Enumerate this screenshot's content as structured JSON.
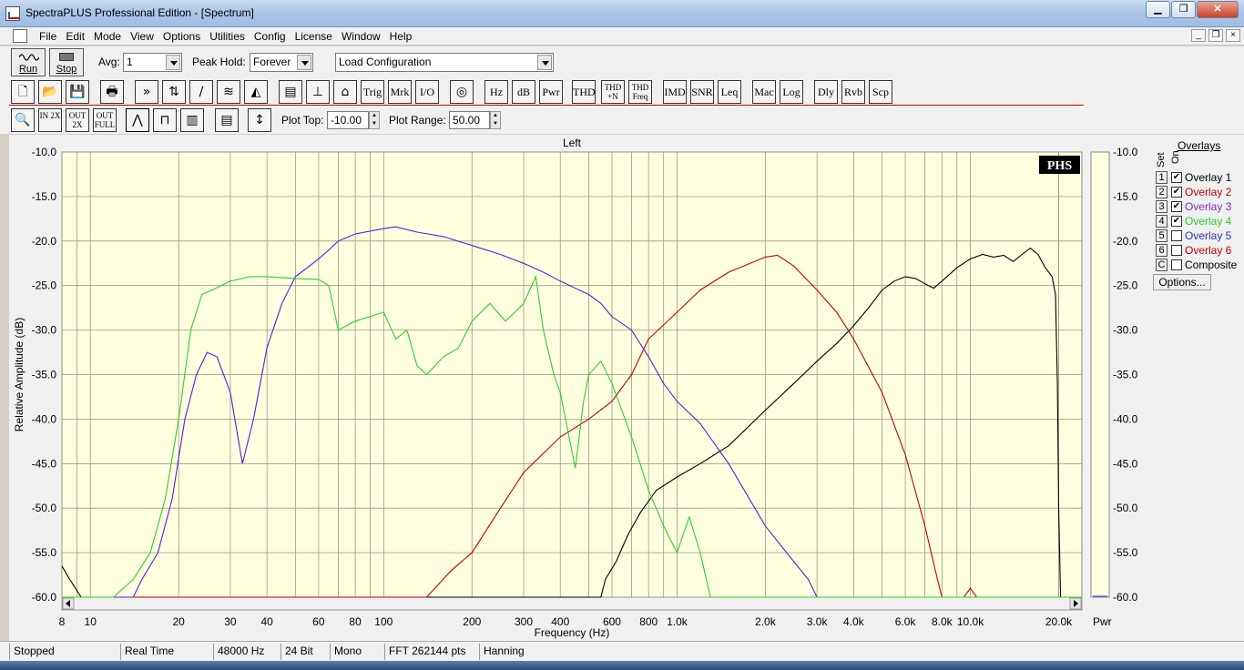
{
  "window": {
    "title": "SpectraPLUS Professional Edition - [Spectrum]"
  },
  "window_buttons": {
    "minimize": "▁",
    "restore": "❐",
    "close": "✕"
  },
  "menu": [
    "File",
    "Edit",
    "Mode",
    "View",
    "Options",
    "Utilities",
    "Config",
    "License",
    "Window",
    "Help"
  ],
  "mdi_buttons": {
    "minimize": "_",
    "restore": "❐",
    "close": "×"
  },
  "toolbar1": {
    "run_label": "Run",
    "stop_label": "Stop",
    "avg_label": "Avg:",
    "avg_value": "1",
    "peakhold_label": "Peak Hold:",
    "peakhold_value": "Forever",
    "config_value": "Load Configuration"
  },
  "toolbar2": {
    "buttons": [
      "Trig",
      "Mrk",
      "I/O",
      "Hz",
      "dB",
      "Pwr",
      "THD",
      "THD +N",
      "THD Freq",
      "IMD",
      "SNR",
      "Leq",
      "Mac",
      "Log",
      "Dly",
      "Rvb",
      "Scp"
    ]
  },
  "toolbar3": {
    "zoom_in_label": "IN 2X",
    "zoom_out_label": "OUT 2X",
    "zoom_full_label": "OUT FULL",
    "plot_top_label": "Plot Top:",
    "plot_top_value": "-10.00",
    "plot_range_label": "Plot Range:",
    "plot_range_value": "50.00"
  },
  "chart_data": {
    "type": "line",
    "title": "Left",
    "xlabel": "Frequency (Hz)",
    "ylabel": "Relative Amplitude (dB)",
    "x_scale": "log",
    "xlim": [
      8,
      24000
    ],
    "ylim": [
      -60,
      -10
    ],
    "x_ticks": [
      {
        "v": 8,
        "t": "8"
      },
      {
        "v": 10,
        "t": "10"
      },
      {
        "v": 20,
        "t": "20"
      },
      {
        "v": 30,
        "t": "30"
      },
      {
        "v": 40,
        "t": "40"
      },
      {
        "v": 60,
        "t": "60"
      },
      {
        "v": 80,
        "t": "80"
      },
      {
        "v": 100,
        "t": "100"
      },
      {
        "v": 200,
        "t": "200"
      },
      {
        "v": 300,
        "t": "300"
      },
      {
        "v": 400,
        "t": "400"
      },
      {
        "v": 600,
        "t": "600"
      },
      {
        "v": 800,
        "t": "800"
      },
      {
        "v": 1000,
        "t": "1.0k"
      },
      {
        "v": 2000,
        "t": "2.0k"
      },
      {
        "v": 3000,
        "t": "3.0k"
      },
      {
        "v": 4000,
        "t": "4.0k"
      },
      {
        "v": 6000,
        "t": "6.0k"
      },
      {
        "v": 8000,
        "t": "8.0k"
      },
      {
        "v": 10000,
        "t": "10.0k"
      },
      {
        "v": 20000,
        "t": "20.0k"
      }
    ],
    "y_ticks": [
      {
        "v": -10,
        "t": "-10.0"
      },
      {
        "v": -15,
        "t": "-15.0"
      },
      {
        "v": -20,
        "t": "-20.0"
      },
      {
        "v": -25,
        "t": "-25.0"
      },
      {
        "v": -30,
        "t": "-30.0"
      },
      {
        "v": -35,
        "t": "-35.0"
      },
      {
        "v": -40,
        "t": "-40.0"
      },
      {
        "v": -45,
        "t": "-45.0"
      },
      {
        "v": -50,
        "t": "-50.0"
      },
      {
        "v": -55,
        "t": "-55.0"
      },
      {
        "v": -60,
        "t": "-60.0"
      }
    ],
    "grid": true,
    "watermark": "PHS",
    "pwr_label": "Pwr",
    "series": [
      {
        "name": "Overlay 1",
        "color": "#000000",
        "points": [
          [
            8,
            -56.5
          ],
          [
            8.5,
            -58
          ],
          [
            9.3,
            -60
          ],
          [
            10,
            -60
          ],
          [
            100,
            -60
          ],
          [
            550,
            -60
          ],
          [
            570,
            -58
          ],
          [
            620,
            -56
          ],
          [
            680,
            -53
          ],
          [
            750,
            -50.5
          ],
          [
            850,
            -48
          ],
          [
            1000,
            -46.5
          ],
          [
            1200,
            -45
          ],
          [
            1500,
            -43
          ],
          [
            2000,
            -39
          ],
          [
            2500,
            -36
          ],
          [
            3000,
            -33.5
          ],
          [
            3500,
            -31.5
          ],
          [
            4000,
            -29.5
          ],
          [
            4500,
            -27.5
          ],
          [
            5000,
            -25.5
          ],
          [
            5500,
            -24.5
          ],
          [
            6000,
            -24
          ],
          [
            6500,
            -24.2
          ],
          [
            7000,
            -24.8
          ],
          [
            7500,
            -25.3
          ],
          [
            8000,
            -24.5
          ],
          [
            9000,
            -23
          ],
          [
            10000,
            -22
          ],
          [
            11000,
            -21.5
          ],
          [
            12000,
            -21.8
          ],
          [
            13000,
            -21.6
          ],
          [
            14000,
            -22.3
          ],
          [
            15000,
            -21.5
          ],
          [
            16000,
            -20.8
          ],
          [
            17000,
            -21.5
          ],
          [
            18000,
            -23
          ],
          [
            19000,
            -24
          ],
          [
            19500,
            -26
          ],
          [
            19800,
            -36
          ],
          [
            20000,
            -50
          ],
          [
            20300,
            -60
          ],
          [
            24000,
            -60
          ]
        ]
      },
      {
        "name": "Overlay 2",
        "color": "#c00000",
        "points": [
          [
            8,
            -60
          ],
          [
            140,
            -60
          ],
          [
            170,
            -57
          ],
          [
            200,
            -55
          ],
          [
            250,
            -50
          ],
          [
            300,
            -46
          ],
          [
            400,
            -42
          ],
          [
            500,
            -40
          ],
          [
            600,
            -38
          ],
          [
            700,
            -35
          ],
          [
            800,
            -31
          ],
          [
            1000,
            -28
          ],
          [
            1200,
            -25.5
          ],
          [
            1500,
            -23.5
          ],
          [
            2000,
            -21.8
          ],
          [
            2200,
            -21.6
          ],
          [
            2500,
            -22.8
          ],
          [
            3000,
            -25.5
          ],
          [
            3500,
            -28
          ],
          [
            4000,
            -31
          ],
          [
            5000,
            -37
          ],
          [
            6000,
            -44
          ],
          [
            7000,
            -52
          ],
          [
            7600,
            -57
          ],
          [
            8000,
            -60
          ],
          [
            9500,
            -60
          ],
          [
            10000,
            -59
          ],
          [
            10500,
            -60
          ],
          [
            24000,
            -60
          ]
        ]
      },
      {
        "name": "Overlay 3",
        "color": "#5a1fd0",
        "points": [
          [
            8,
            -60
          ],
          [
            14,
            -60
          ],
          [
            15,
            -58
          ],
          [
            17,
            -55
          ],
          [
            19,
            -49
          ],
          [
            21,
            -40
          ],
          [
            23,
            -35
          ],
          [
            25,
            -32.5
          ],
          [
            27,
            -33
          ],
          [
            30,
            -37
          ],
          [
            33,
            -45
          ],
          [
            36,
            -40
          ],
          [
            40,
            -32
          ],
          [
            45,
            -27
          ],
          [
            50,
            -24
          ],
          [
            60,
            -22
          ],
          [
            65,
            -21
          ],
          [
            70,
            -20
          ],
          [
            80,
            -19.2
          ],
          [
            100,
            -18.6
          ],
          [
            110,
            -18.4
          ],
          [
            130,
            -19
          ],
          [
            160,
            -19.5
          ],
          [
            200,
            -20.5
          ],
          [
            250,
            -21.5
          ],
          [
            300,
            -22.5
          ],
          [
            350,
            -23.5
          ],
          [
            400,
            -24.5
          ],
          [
            500,
            -26
          ],
          [
            550,
            -27
          ],
          [
            600,
            -28.5
          ],
          [
            700,
            -30
          ],
          [
            800,
            -33
          ],
          [
            900,
            -36
          ],
          [
            1000,
            -38
          ],
          [
            1200,
            -40.5
          ],
          [
            1500,
            -45
          ],
          [
            2000,
            -52
          ],
          [
            2500,
            -56
          ],
          [
            2800,
            -58
          ],
          [
            3000,
            -60
          ],
          [
            24000,
            -60
          ]
        ]
      },
      {
        "name": "Overlay 4",
        "color": "#2ecc2e",
        "points": [
          [
            8,
            -60
          ],
          [
            12,
            -60
          ],
          [
            14,
            -58
          ],
          [
            16,
            -55
          ],
          [
            18,
            -49
          ],
          [
            20,
            -40
          ],
          [
            22,
            -30
          ],
          [
            24,
            -26
          ],
          [
            26,
            -25.5
          ],
          [
            30,
            -24.5
          ],
          [
            35,
            -24
          ],
          [
            40,
            -24
          ],
          [
            50,
            -24.2
          ],
          [
            60,
            -24.3
          ],
          [
            65,
            -25
          ],
          [
            70,
            -30
          ],
          [
            80,
            -29
          ],
          [
            100,
            -28
          ],
          [
            110,
            -31
          ],
          [
            120,
            -30
          ],
          [
            130,
            -34
          ],
          [
            140,
            -35
          ],
          [
            160,
            -33
          ],
          [
            180,
            -32
          ],
          [
            200,
            -29
          ],
          [
            230,
            -27
          ],
          [
            260,
            -29
          ],
          [
            280,
            -28
          ],
          [
            300,
            -27
          ],
          [
            330,
            -24
          ],
          [
            350,
            -30
          ],
          [
            380,
            -35
          ],
          [
            400,
            -37
          ],
          [
            450,
            -45.5
          ],
          [
            480,
            -38
          ],
          [
            500,
            -35
          ],
          [
            550,
            -33.5
          ],
          [
            600,
            -36
          ],
          [
            700,
            -42
          ],
          [
            800,
            -48
          ],
          [
            900,
            -52
          ],
          [
            1000,
            -55
          ],
          [
            1100,
            -51
          ],
          [
            1200,
            -55
          ],
          [
            1300,
            -60
          ],
          [
            24000,
            -60
          ]
        ]
      }
    ]
  },
  "overlays": {
    "title": "Overlays",
    "hdr_set": "Set",
    "hdr_on": "On",
    "rows": [
      {
        "num": "1",
        "checked": "✔",
        "name": "Overlay 1",
        "color": "#000000"
      },
      {
        "num": "2",
        "checked": "✔",
        "name": "Overlay 2",
        "color": "#c00000"
      },
      {
        "num": "3",
        "checked": "✔",
        "name": "Overlay 3",
        "color": "#7b2fd0"
      },
      {
        "num": "4",
        "checked": "✔",
        "name": "Overlay 4",
        "color": "#2ecc2e"
      },
      {
        "num": "5",
        "checked": "",
        "name": "Overlay 5",
        "color": "#3030c0"
      },
      {
        "num": "6",
        "checked": "",
        "name": "Overlay 6",
        "color": "#c00000"
      },
      {
        "num": "C",
        "checked": "",
        "name": "Composite",
        "color": "#000000"
      }
    ],
    "options_label": "Options..."
  },
  "status": [
    "Stopped",
    "Real Time",
    "48000 Hz",
    "24 Bit",
    "Mono",
    "FFT 262144 pts",
    "Hanning"
  ]
}
